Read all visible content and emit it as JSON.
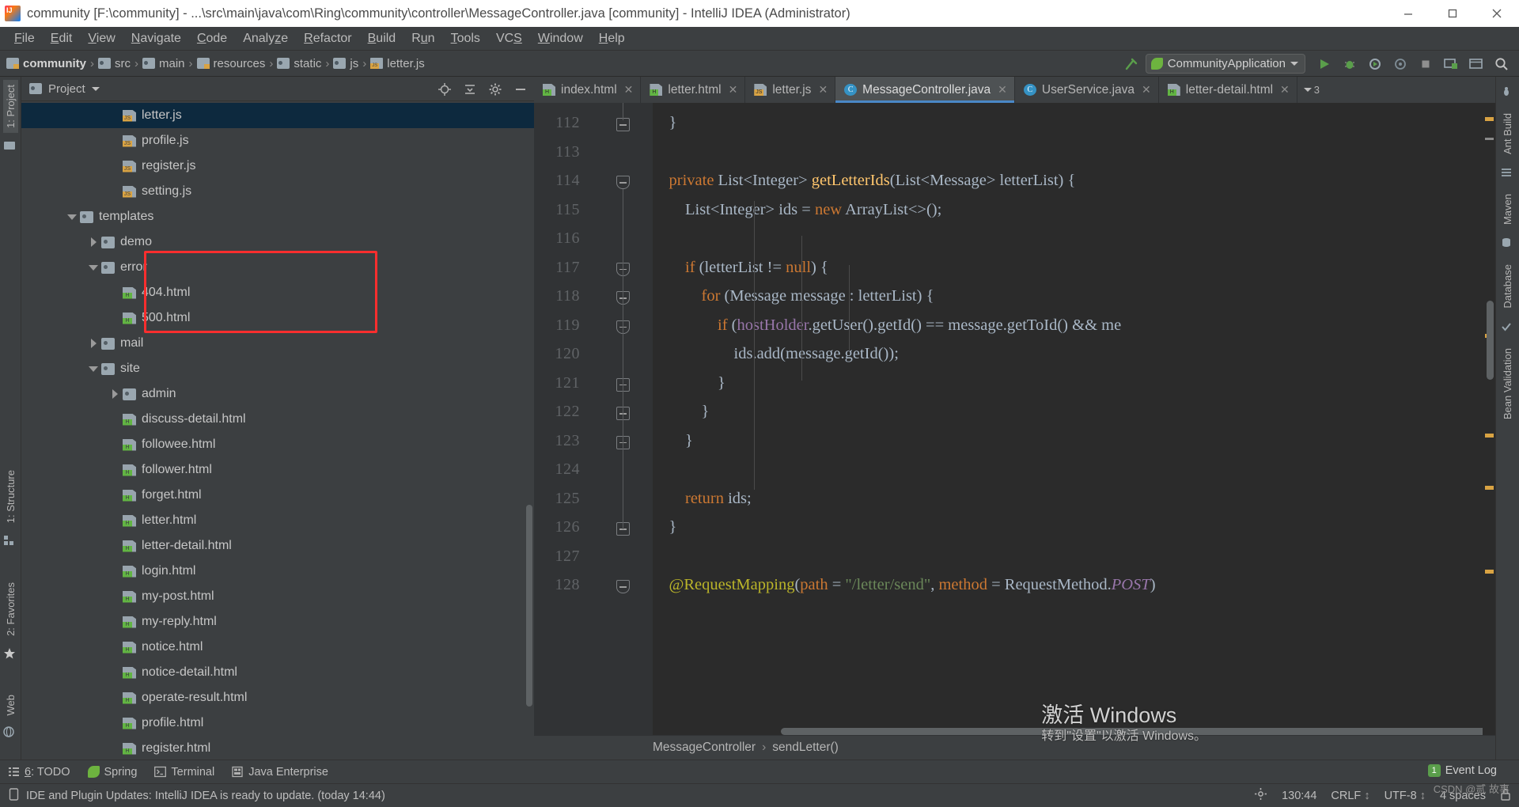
{
  "window": {
    "title": "community [F:\\community] - ...\\src\\main\\java\\com\\Ring\\community\\controller\\MessageController.java [community] - IntelliJ IDEA (Administrator)",
    "icon": "intellij-idea-icon",
    "minimize_label": "—",
    "maximize_label": "□",
    "close_label": "✕"
  },
  "menubar": {
    "items": [
      {
        "label": "File",
        "mnemonic": "F"
      },
      {
        "label": "Edit",
        "mnemonic": "E"
      },
      {
        "label": "View",
        "mnemonic": "V"
      },
      {
        "label": "Navigate",
        "mnemonic": "N"
      },
      {
        "label": "Code",
        "mnemonic": "C"
      },
      {
        "label": "Analyze",
        "mnemonic": "z"
      },
      {
        "label": "Refactor",
        "mnemonic": "R"
      },
      {
        "label": "Build",
        "mnemonic": "B"
      },
      {
        "label": "Run",
        "mnemonic": "u"
      },
      {
        "label": "Tools",
        "mnemonic": "T"
      },
      {
        "label": "VCS",
        "mnemonic": "S"
      },
      {
        "label": "Window",
        "mnemonic": "W"
      },
      {
        "label": "Help",
        "mnemonic": "H"
      }
    ]
  },
  "navbar": {
    "breadcrumbs": [
      {
        "label": "community",
        "icon": "folder-module-icon",
        "bold": true
      },
      {
        "label": "src",
        "icon": "folder-icon",
        "bold": false
      },
      {
        "label": "main",
        "icon": "folder-icon",
        "bold": false
      },
      {
        "label": "resources",
        "icon": "folder-resources-icon",
        "bold": false
      },
      {
        "label": "static",
        "icon": "folder-icon",
        "bold": false
      },
      {
        "label": "js",
        "icon": "folder-icon",
        "bold": false
      },
      {
        "label": "letter.js",
        "icon": "js-file-icon",
        "bold": false
      }
    ],
    "separator": "›",
    "run_configuration": "CommunityApplication",
    "buttons": [
      {
        "name": "build-hammer-button",
        "label": "build"
      },
      {
        "name": "run-button",
        "label": "Run"
      },
      {
        "name": "debug-button",
        "label": "Debug"
      },
      {
        "name": "run-coverage-button",
        "label": "Run with Coverage"
      },
      {
        "name": "profile-button",
        "label": "Profile"
      },
      {
        "name": "stop-button",
        "label": "Stop"
      },
      {
        "name": "update-app-button",
        "label": "Update Application"
      },
      {
        "name": "open-browser-button",
        "label": "Open in Browser"
      },
      {
        "name": "search-everywhere-button",
        "label": "Search Everywhere"
      }
    ]
  },
  "left_strip": {
    "tabs": [
      {
        "label": "1: Project",
        "selected": true
      },
      {
        "label": "1: Structure",
        "selected": false
      },
      {
        "label": "2: Favorites",
        "selected": false
      },
      {
        "label": "Web",
        "selected": false
      }
    ]
  },
  "right_strip": {
    "tabs": [
      {
        "label": "Ant Build"
      },
      {
        "label": "Maven"
      },
      {
        "label": "Database"
      },
      {
        "label": "Bean Validation"
      }
    ]
  },
  "project_panel": {
    "title": "Project",
    "tools": [
      {
        "name": "locate-file-icon"
      },
      {
        "name": "collapse-all-icon"
      },
      {
        "name": "settings-gear-icon"
      },
      {
        "name": "hide-panel-icon"
      }
    ],
    "tree": [
      {
        "label": "letter.js",
        "indent": 4,
        "icon": "js",
        "twisty": "none",
        "selected": true
      },
      {
        "label": "profile.js",
        "indent": 4,
        "icon": "js",
        "twisty": "none",
        "selected": false
      },
      {
        "label": "register.js",
        "indent": 4,
        "icon": "js",
        "twisty": "none",
        "selected": false
      },
      {
        "label": "setting.js",
        "indent": 4,
        "icon": "js",
        "twisty": "none",
        "selected": false
      },
      {
        "label": "templates",
        "indent": 2,
        "icon": "dir",
        "twisty": "down",
        "selected": false
      },
      {
        "label": "demo",
        "indent": 3,
        "icon": "dir",
        "twisty": "right",
        "selected": false
      },
      {
        "label": "error",
        "indent": 3,
        "icon": "dir",
        "twisty": "down",
        "selected": false
      },
      {
        "label": "404.html",
        "indent": 4,
        "icon": "html",
        "twisty": "none",
        "selected": false
      },
      {
        "label": "500.html",
        "indent": 4,
        "icon": "html",
        "twisty": "none",
        "selected": false
      },
      {
        "label": "mail",
        "indent": 3,
        "icon": "dir",
        "twisty": "right",
        "selected": false
      },
      {
        "label": "site",
        "indent": 3,
        "icon": "dir",
        "twisty": "down",
        "selected": false
      },
      {
        "label": "admin",
        "indent": 4,
        "icon": "dir",
        "twisty": "right",
        "selected": false
      },
      {
        "label": "discuss-detail.html",
        "indent": 4,
        "icon": "html",
        "twisty": "none",
        "selected": false
      },
      {
        "label": "followee.html",
        "indent": 4,
        "icon": "html",
        "twisty": "none",
        "selected": false
      },
      {
        "label": "follower.html",
        "indent": 4,
        "icon": "html",
        "twisty": "none",
        "selected": false
      },
      {
        "label": "forget.html",
        "indent": 4,
        "icon": "html",
        "twisty": "none",
        "selected": false
      },
      {
        "label": "letter.html",
        "indent": 4,
        "icon": "html",
        "twisty": "none",
        "selected": false
      },
      {
        "label": "letter-detail.html",
        "indent": 4,
        "icon": "html",
        "twisty": "none",
        "selected": false
      },
      {
        "label": "login.html",
        "indent": 4,
        "icon": "html",
        "twisty": "none",
        "selected": false
      },
      {
        "label": "my-post.html",
        "indent": 4,
        "icon": "html",
        "twisty": "none",
        "selected": false
      },
      {
        "label": "my-reply.html",
        "indent": 4,
        "icon": "html",
        "twisty": "none",
        "selected": false
      },
      {
        "label": "notice.html",
        "indent": 4,
        "icon": "html",
        "twisty": "none",
        "selected": false
      },
      {
        "label": "notice-detail.html",
        "indent": 4,
        "icon": "html",
        "twisty": "none",
        "selected": false
      },
      {
        "label": "operate-result.html",
        "indent": 4,
        "icon": "html",
        "twisty": "none",
        "selected": false
      },
      {
        "label": "profile.html",
        "indent": 4,
        "icon": "html",
        "twisty": "none",
        "selected": false
      },
      {
        "label": "register.html",
        "indent": 4,
        "icon": "html",
        "twisty": "none",
        "selected": false
      }
    ],
    "highlight_note": "red-annotation-box around error folder"
  },
  "editor": {
    "tabs": [
      {
        "label": "index.html",
        "icon": "html",
        "active": false,
        "close": "✕"
      },
      {
        "label": "letter.html",
        "icon": "html",
        "active": false,
        "close": "✕"
      },
      {
        "label": "letter.js",
        "icon": "js",
        "active": false,
        "close": "✕"
      },
      {
        "label": "MessageController.java",
        "icon": "java",
        "active": true,
        "close": "✕"
      },
      {
        "label": "UserService.java",
        "icon": "java",
        "active": false,
        "close": "✕"
      },
      {
        "label": "letter-detail.html",
        "icon": "html",
        "active": false,
        "close": "✕"
      }
    ],
    "tabs_overflow": "3",
    "breadcrumb": [
      "MessageController",
      "sendLetter()"
    ],
    "breadcrumb_separator": "›",
    "lines": [
      {
        "n": 112,
        "fold": "end",
        "text": "    }"
      },
      {
        "n": 113,
        "fold": "none",
        "text": ""
      },
      {
        "n": 114,
        "fold": "start",
        "text": "    private List<Integer> getLetterIds(List<Message> letterList) {"
      },
      {
        "n": 115,
        "fold": "none",
        "text": "        List<Integer> ids = new ArrayList<>();"
      },
      {
        "n": 116,
        "fold": "none",
        "text": ""
      },
      {
        "n": 117,
        "fold": "start",
        "text": "        if (letterList != null) {"
      },
      {
        "n": 118,
        "fold": "start",
        "text": "            for (Message message : letterList) {"
      },
      {
        "n": 119,
        "fold": "start",
        "text": "                if (hostHolder.getUser().getId() == message.getToId() && me"
      },
      {
        "n": 120,
        "fold": "none",
        "text": "                    ids.add(message.getId());"
      },
      {
        "n": 121,
        "fold": "end",
        "text": "                }"
      },
      {
        "n": 122,
        "fold": "end",
        "text": "            }"
      },
      {
        "n": 123,
        "fold": "end",
        "text": "        }"
      },
      {
        "n": 124,
        "fold": "none",
        "text": ""
      },
      {
        "n": 125,
        "fold": "none",
        "text": "        return ids;"
      },
      {
        "n": 126,
        "fold": "end",
        "text": "    }"
      },
      {
        "n": 127,
        "fold": "none",
        "text": ""
      },
      {
        "n": 128,
        "fold": "start",
        "text": "    @RequestMapping(path = \"/letter/send\", method = RequestMethod.POST)"
      }
    ]
  },
  "bottom_bar": {
    "items": [
      {
        "label": "6: TODO",
        "mnemonic": "6",
        "icon": "todo-icon"
      },
      {
        "label": "Spring",
        "mnemonic": "",
        "icon": "spring-leaf-icon"
      },
      {
        "label": "Terminal",
        "mnemonic": "",
        "icon": "terminal-icon"
      },
      {
        "label": "Java Enterprise",
        "mnemonic": "",
        "icon": "java-enterprise-icon"
      }
    ]
  },
  "status_bar": {
    "message": "IDE and Plugin Updates: IntelliJ IDEA is ready to update. (today 14:44)",
    "message_icon": "notification-icon",
    "caret_position": "130:44",
    "line_separator": "CRLF",
    "encoding": "UTF-8",
    "indent": "4 spaces",
    "lock_icon": "lock-icon",
    "settings_icon": "event-settings-icon"
  },
  "event_log": {
    "label": "Event Log",
    "badge": "1"
  },
  "watermark": {
    "line1": "激活 Windows",
    "line2": "转到\"设置\"以激活 Windows。"
  },
  "csdn": "CSDN @贰 故事",
  "colors": {
    "panel_bg": "#3c3f41",
    "editor_bg": "#2b2b2b",
    "gutter_bg": "#313335",
    "selection_bg": "#0d293e",
    "accent_blue": "#4a88c7",
    "keyword_orange": "#cc7832",
    "string_green": "#6a8759",
    "number_blue": "#6897bb",
    "text_grey": "#a9b7c6",
    "method_yellow": "#ffc66d",
    "field_purple": "#9876aa",
    "annotation_yellow": "#bbb529",
    "annotation_box_red": "#fb2e2e",
    "java_icon_blue": "#3592c4",
    "html_icon_green": "#62b543",
    "js_icon_orange": "#d9a343"
  }
}
